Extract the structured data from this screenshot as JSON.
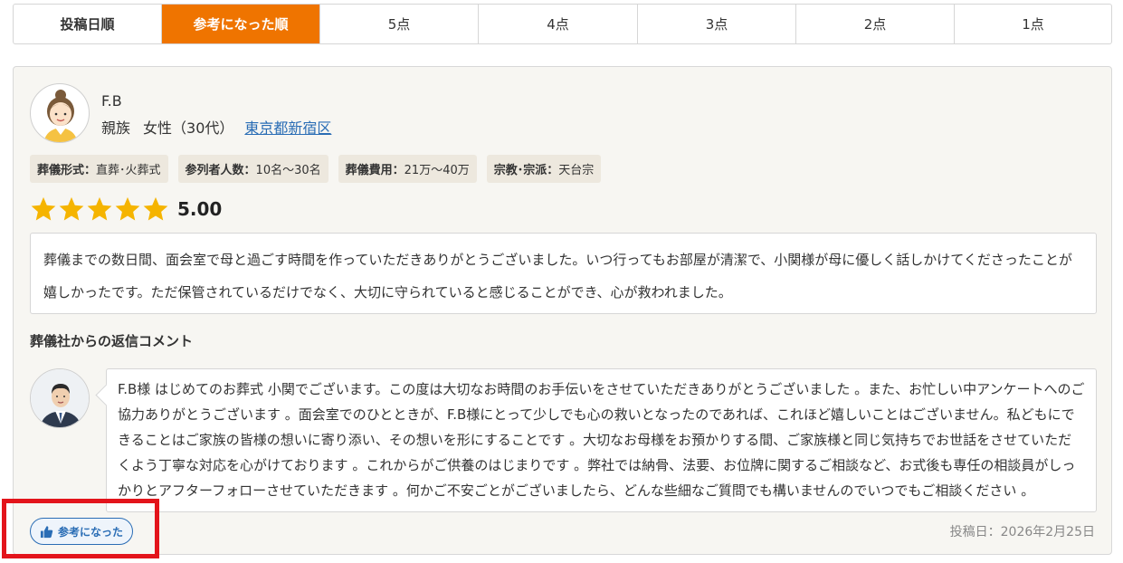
{
  "tabs": [
    {
      "label": "投稿日順"
    },
    {
      "label": "参考になった順"
    },
    {
      "label": "5点"
    },
    {
      "label": "4点"
    },
    {
      "label": "3点"
    },
    {
      "label": "2点"
    },
    {
      "label": "1点"
    }
  ],
  "review": {
    "reviewer": {
      "name": "F.B",
      "relation": "親族",
      "gender_age": "女性（30代）",
      "area": "東京都新宿区"
    },
    "tags": [
      {
        "key": "葬儀形式：",
        "value": "直葬･火葬式"
      },
      {
        "key": "参列者人数：",
        "value": "10名〜30名"
      },
      {
        "key": "葬儀費用：",
        "value": "21万〜40万"
      },
      {
        "key": "宗教･宗派：",
        "value": "天台宗"
      }
    ],
    "rating": {
      "stars": 5,
      "score": "5.00",
      "star_color": "#f5b400"
    },
    "body": "葬儀までの数日間、面会室で母と過ごす時間を作っていただきありがとうございました。いつ行ってもお部屋が清潔で、小関様が母に優しく話しかけてくださったことが嬉しかったです。ただ保管されているだけでなく、大切に守られていると感じることができ、心が救われました。",
    "reply_heading": "葬儀社からの返信コメント",
    "reply": "F.B様 はじめてのお葬式 小関でございます。この度は大切なお時間のお手伝いをさせていただきありがとうございました 。また、お忙しい中アンケートへのご協力ありがとうございます 。面会室でのひとときが、F.B様にとって少しでも心の救いとなったのであれば、これほど嬉しいことはございません。私どもにできることはご家族の皆様の想いに寄り添い、その想いを形にすることです 。大切なお母様をお預かりする間、ご家族様と同じ気持ちでお世話をさせていただくよう丁寧な対応を心がけております 。これからがご供養のはじまりです 。弊社では納骨、法要、お位牌に関するご相談など、お式後も専任の相談員がしっかりとアフターフォローさせていただきます 。何かご不安ごとがございましたら、どんな些細なご質問でも構いませんのでいつでもご相談ください 。",
    "helpful_label": "参考になった",
    "post_date": "投稿日：2026年2月25日"
  },
  "colors": {
    "accent": "#ef7400",
    "link": "#2a6db5",
    "highlight": "#e3141b"
  }
}
